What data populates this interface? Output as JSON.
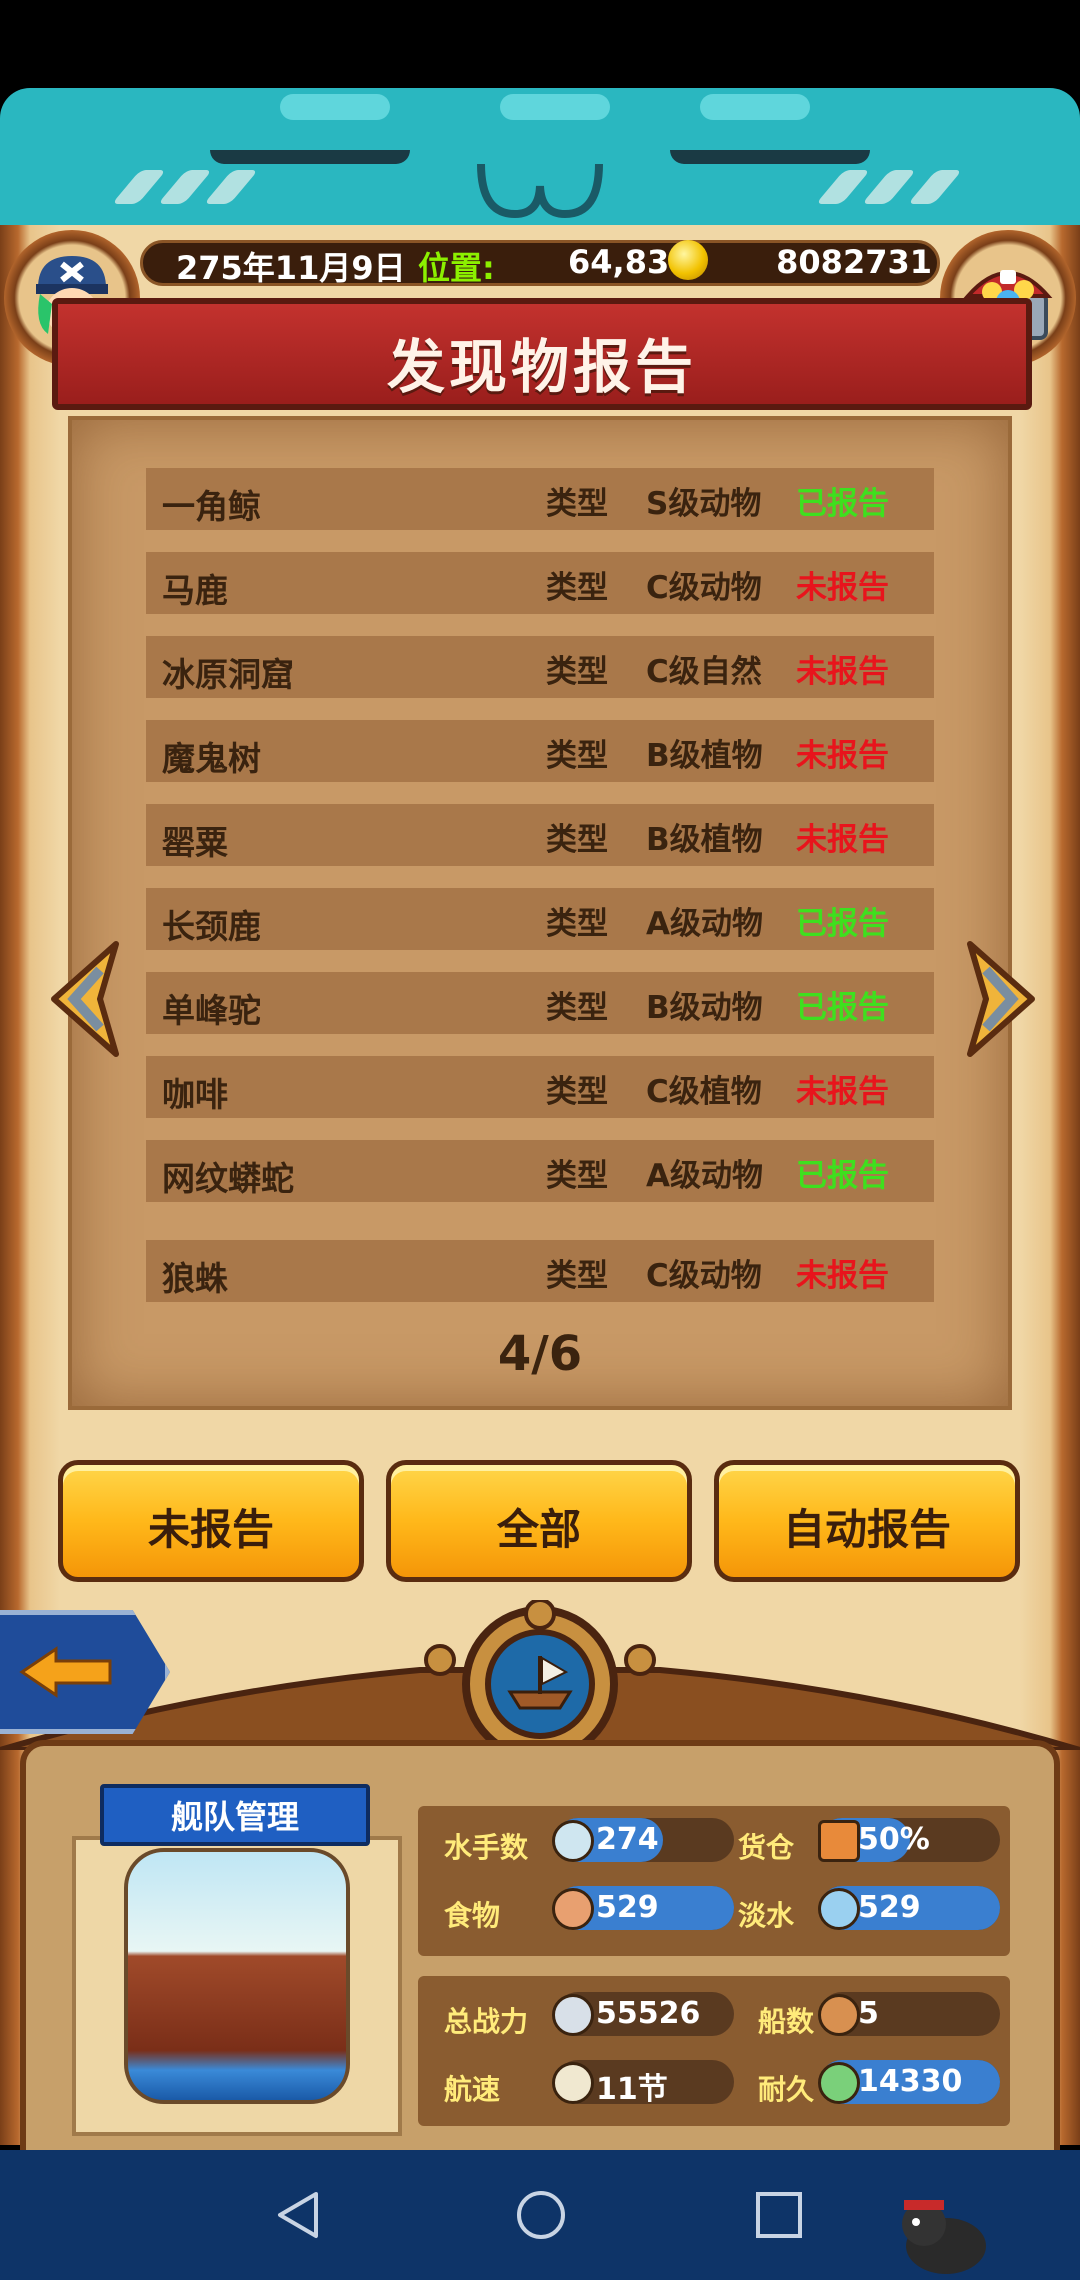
{
  "header": {
    "date": "275年11月9日",
    "position_label": "位置:",
    "position_value": "64,83",
    "gold": "8082731"
  },
  "title": "发现物报告",
  "rows": [
    {
      "name": "一角鲸",
      "type_label": "类型",
      "type": "S级动物",
      "status": "已报告",
      "reported": true
    },
    {
      "name": "马鹿",
      "type_label": "类型",
      "type": "C级动物",
      "status": "未报告",
      "reported": false
    },
    {
      "name": "冰原洞窟",
      "type_label": "类型",
      "type": "C级自然",
      "status": "未报告",
      "reported": false
    },
    {
      "name": "魔鬼树",
      "type_label": "类型",
      "type": "B级植物",
      "status": "未报告",
      "reported": false
    },
    {
      "name": "罂粟",
      "type_label": "类型",
      "type": "B级植物",
      "status": "未报告",
      "reported": false
    },
    {
      "name": "长颈鹿",
      "type_label": "类型",
      "type": "A级动物",
      "status": "已报告",
      "reported": true
    },
    {
      "name": "单峰驼",
      "type_label": "类型",
      "type": "B级动物",
      "status": "已报告",
      "reported": true
    },
    {
      "name": "咖啡",
      "type_label": "类型",
      "type": "C级植物",
      "status": "未报告",
      "reported": false
    },
    {
      "name": "网纹蟒蛇",
      "type_label": "类型",
      "type": "A级动物",
      "status": "已报告",
      "reported": true
    },
    {
      "name": "狼蛛",
      "type_label": "类型",
      "type": "C级动物",
      "status": "未报告",
      "reported": false
    }
  ],
  "colors": {
    "reported": "#3ee01e",
    "unreported": "#e8141c"
  },
  "page_indicator": "4/6",
  "buttons": {
    "unreported": "未报告",
    "all": "全部",
    "auto_report": "自动报告"
  },
  "fleet": {
    "title": "舰队管理",
    "sailors_label": "水手数",
    "sailors_value": "274",
    "sailors_fraction": 0.6,
    "cargo_label": "货仓",
    "cargo_value": "50%",
    "cargo_fraction": 0.5,
    "food_label": "食物",
    "food_value": "529",
    "food_fraction": 1.0,
    "water_label": "淡水",
    "water_value": "529",
    "water_fraction": 1.0,
    "power_label": "总战力",
    "power_value": "55526",
    "ships_label": "船数",
    "ships_value": "5",
    "speed_label": "航速",
    "speed_value": "11节",
    "durability_label": "耐久",
    "durability_value": "14330",
    "durability_fraction": 1.0
  },
  "icons": {
    "coin": "coin-icon",
    "avatar": "pirate-avatar-icon",
    "chest": "treasure-chest-icon",
    "prev": "arrow-left-icon",
    "next": "arrow-right-icon",
    "back": "back-arrow-icon",
    "ship": "ship-icon"
  }
}
